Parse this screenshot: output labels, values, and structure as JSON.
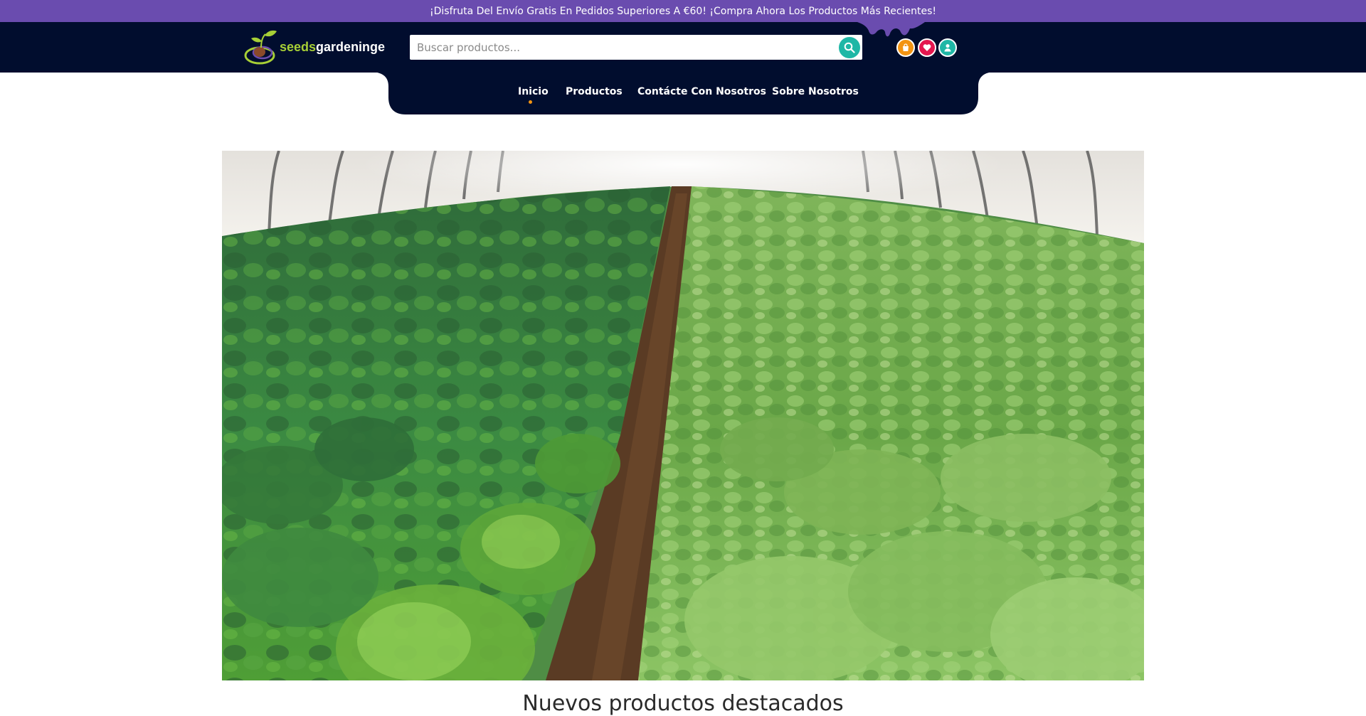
{
  "promo": {
    "text": "¡Disfruta Del Envío Gratis En Pedidos Superiores A €60! ¡Compra Ahora Los Productos Más Recientes!"
  },
  "header": {
    "logo": {
      "part1": "seeds",
      "part2": "gardeninge"
    },
    "search": {
      "placeholder": "Buscar productos...",
      "value": ""
    },
    "icons": [
      "search-icon",
      "cart-icon",
      "heart-icon",
      "user-icon"
    ]
  },
  "nav": {
    "items": [
      {
        "label": "Inicio",
        "active": true
      },
      {
        "label": "Productos"
      },
      {
        "label": "Contácte Con Nosotros"
      },
      {
        "label": "Sobre Nosotros"
      }
    ]
  },
  "main": {
    "section_title": "Nuevos productos destacados"
  },
  "colors": {
    "promo_bg": "#6a4caf",
    "header_bg": "#010d2e",
    "accent_teal": "#1fb7a6",
    "accent_orange": "#f39412",
    "accent_red": "#e4174f",
    "logo_green": "#a7cf36"
  }
}
